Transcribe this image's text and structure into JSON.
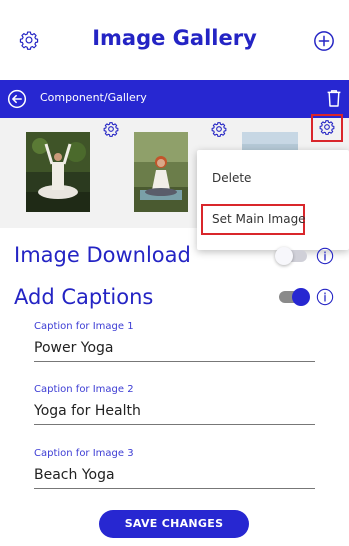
{
  "header": {
    "title": "Image Gallery"
  },
  "toolbar": {
    "breadcrumb": "Component/Gallery"
  },
  "context_menu": {
    "delete_label": "Delete",
    "set_main_label": "Set Main Image"
  },
  "settings": {
    "image_download": {
      "label": "Image Download",
      "enabled": false
    },
    "add_captions": {
      "label": "Add Captions",
      "enabled": true
    }
  },
  "captions": [
    {
      "label": "Caption for Image 1",
      "value": "Power Yoga"
    },
    {
      "label": "Caption for Image 2",
      "value": "Yoga for Health"
    },
    {
      "label": "Caption for Image 3",
      "value": "Beach Yoga"
    }
  ],
  "actions": {
    "save_label": "SAVE CHANGES"
  },
  "colors": {
    "accent": "#2727d1",
    "highlight": "#d9262b"
  }
}
